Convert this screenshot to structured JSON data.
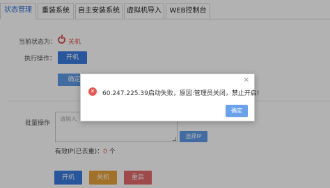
{
  "tabs": [
    {
      "label": "状态管理",
      "active": true
    },
    {
      "label": "重装系统"
    },
    {
      "label": "自主安装系统"
    },
    {
      "label": "虚拟机导入"
    },
    {
      "label": "WEB控制台"
    }
  ],
  "status": {
    "label": "当前状态为：",
    "value": "关机",
    "color": "#d9534f"
  },
  "action": {
    "label": "执行操作：",
    "start_button": "开机",
    "confirm_button": "确定更"
  },
  "batch": {
    "label": "批量操作",
    "ip_placeholder": "请输入",
    "select_ip_button": "选择IP",
    "valid_ip_label": "有效IP(已去重)：",
    "valid_ip_count": "0",
    "valid_ip_unit": "个"
  },
  "bottom_buttons": {
    "start": "开机",
    "shutdown": "关机",
    "restart": "重启"
  },
  "dialog": {
    "message": "60.247.225.39启动失败，原因:管理员关闭，禁止开启!",
    "ok_button": "确定",
    "close_symbol": "×",
    "error_symbol": "✕"
  },
  "colors": {
    "accent": "#3a7ce0",
    "error": "#e8554e",
    "warning": "#e8a23a",
    "danger": "#e26a6a"
  }
}
